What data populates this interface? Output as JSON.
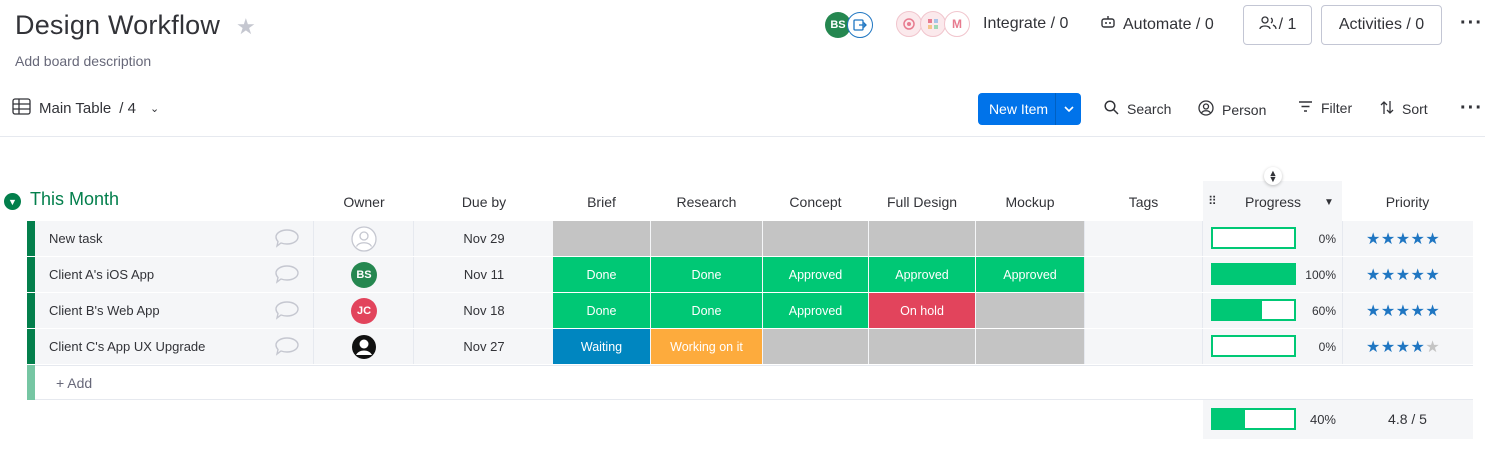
{
  "board": {
    "title": "Design Workflow",
    "description": "Add board description"
  },
  "header": {
    "avatar_initials": "BS",
    "integrate_label": "Integrate / 0",
    "automate_label": "Automate / 0",
    "members_count": "/ 1",
    "activities_label": "Activities / 0",
    "integration_letter": "M"
  },
  "toolbar": {
    "table_label": "Main Table",
    "table_count": "/ 4",
    "new_item_label": "New Item",
    "search_label": "Search",
    "person_label": "Person",
    "filter_label": "Filter",
    "sort_label": "Sort"
  },
  "group": {
    "title": "This Month",
    "columns": {
      "owner": "Owner",
      "due": "Due by",
      "brief": "Brief",
      "research": "Research",
      "concept": "Concept",
      "full_design": "Full Design",
      "mockup": "Mockup",
      "tags": "Tags",
      "progress": "Progress",
      "priority": "Priority"
    },
    "rows": [
      {
        "name": "New task",
        "owner": "",
        "due": "Nov 29",
        "brief": "",
        "research": "",
        "concept": "",
        "full_design": "",
        "mockup": "",
        "progress": 0,
        "progress_label": "0%",
        "priority": 5
      },
      {
        "name": "Client A's iOS App",
        "owner": "BS",
        "due": "Nov 11",
        "brief": "Done",
        "research": "Done",
        "concept": "Approved",
        "full_design": "Approved",
        "mockup": "Approved",
        "progress": 100,
        "progress_label": "100%",
        "priority": 5
      },
      {
        "name": "Client B's Web App",
        "owner": "JC",
        "due": "Nov 18",
        "brief": "Done",
        "research": "Done",
        "concept": "Approved",
        "full_design": "On hold",
        "mockup": "",
        "progress": 60,
        "progress_label": "60%",
        "priority": 5
      },
      {
        "name": "Client C's App UX Upgrade",
        "owner": "",
        "due": "Nov 27",
        "brief": "Waiting",
        "research": "Working on it",
        "concept": "",
        "full_design": "",
        "mockup": "",
        "progress": 0,
        "progress_label": "0%",
        "priority": 4
      }
    ],
    "add_label": "+ Add",
    "summary": {
      "progress": 40,
      "progress_label": "40%",
      "priority_label": "4.8  / 5"
    }
  },
  "colors": {
    "accent": "#0073ea",
    "group": "#037f4c",
    "done": "#00c875",
    "empty": "#c4c4c4",
    "hold": "#e2445c",
    "waiting": "#0086c0",
    "working": "#fdab3d",
    "star": "#1f76c2"
  },
  "icons": {
    "board_star": "star-icon",
    "table": "table-icon",
    "search": "search-icon",
    "person": "person-icon",
    "filter": "filter-icon",
    "sort": "sort-icon",
    "comment": "comment-icon"
  }
}
